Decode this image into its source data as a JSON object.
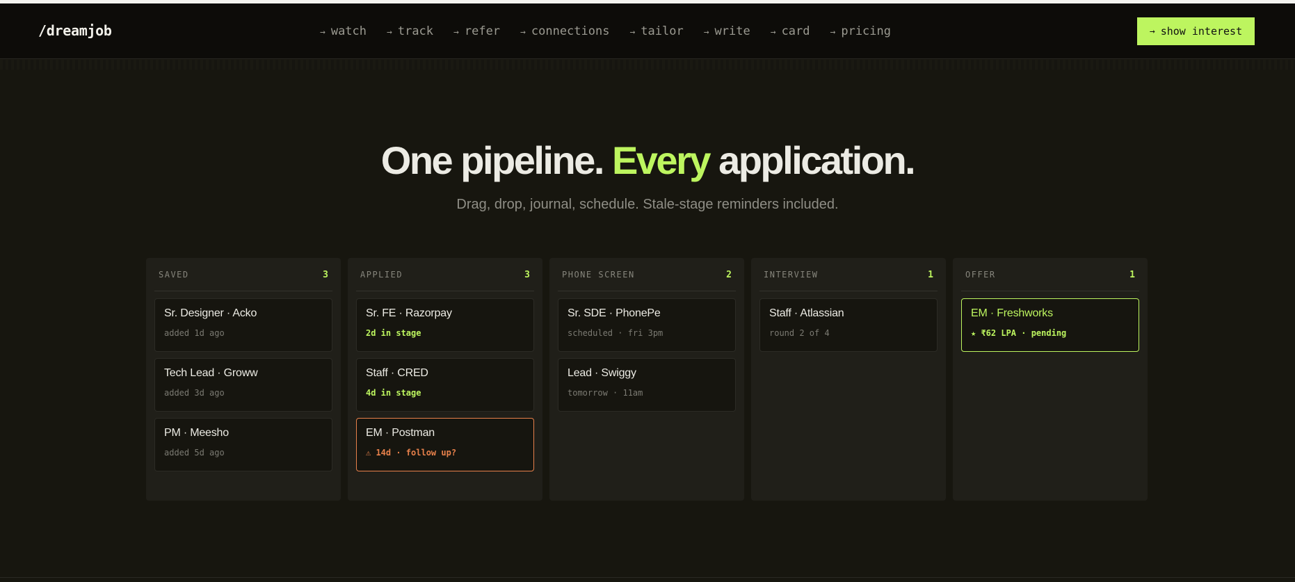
{
  "nav": {
    "logo": "/dreamjob",
    "links": [
      {
        "arrow": "→",
        "label": "watch"
      },
      {
        "arrow": "→",
        "label": "track"
      },
      {
        "arrow": "→",
        "label": "refer"
      },
      {
        "arrow": "→",
        "label": "connections"
      },
      {
        "arrow": "→",
        "label": "tailor"
      },
      {
        "arrow": "→",
        "label": "write"
      },
      {
        "arrow": "→",
        "label": "card"
      },
      {
        "arrow": "→",
        "label": "pricing"
      }
    ],
    "cta": {
      "arrow": "→",
      "label": "show interest"
    }
  },
  "hero": {
    "title_part1": "One pipeline. ",
    "title_accent": "Every",
    "title_part2": " application.",
    "subtitle": "Drag, drop, journal, schedule. Stale-stage reminders included."
  },
  "board": {
    "columns": [
      {
        "title": "SAVED",
        "count": "3",
        "cards": [
          {
            "title": "Sr. Designer · Acko",
            "meta": "added 1d ago"
          },
          {
            "title": "Tech Lead · Groww",
            "meta": "added 3d ago"
          },
          {
            "title": "PM · Meesho",
            "meta": "added 5d ago"
          }
        ]
      },
      {
        "title": "APPLIED",
        "count": "3",
        "cards": [
          {
            "title": "Sr. FE · Razorpay",
            "meta": "2d in stage"
          },
          {
            "title": "Staff · CRED",
            "meta": "4d in stage"
          },
          {
            "title": "EM · Postman",
            "meta": "⚠ 14d · follow up?"
          }
        ]
      },
      {
        "title": "PHONE SCREEN",
        "count": "2",
        "cards": [
          {
            "title": "Sr. SDE · PhonePe",
            "meta": "scheduled · fri 3pm"
          },
          {
            "title": "Lead · Swiggy",
            "meta": "tomorrow · 11am"
          }
        ]
      },
      {
        "title": "INTERVIEW",
        "count": "1",
        "cards": [
          {
            "title": "Staff · Atlassian",
            "meta": "round 2 of 4"
          }
        ]
      },
      {
        "title": "OFFER",
        "count": "1",
        "cards": [
          {
            "title": "EM · Freshworks",
            "meta": "★ ₹62 LPA · pending"
          }
        ]
      }
    ]
  },
  "colors": {
    "accent": "#bdf55f",
    "warning": "#e8814b",
    "background": "#17160f",
    "nav_background": "#0d0c09",
    "column_background": "#201f19"
  }
}
